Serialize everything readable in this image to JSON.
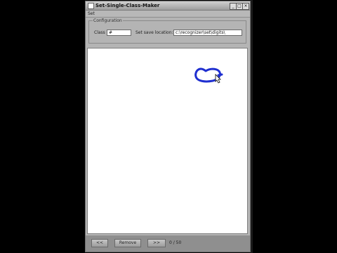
{
  "window": {
    "title": "Set-Single-Class-Maker",
    "minimize_label": "_",
    "maximize_label": "□",
    "close_label": "×"
  },
  "menu": {
    "items": [
      "Set"
    ]
  },
  "config": {
    "group_title": "Configuration",
    "class_label": "Class",
    "class_value": "#",
    "save_location_label": "Set save location:",
    "save_location_value": "c:\\recognizer\\set\\digits\\"
  },
  "canvas": {
    "stroke_color": "#1f2fd0"
  },
  "bottom": {
    "prev_label": "<<",
    "remove_label": "Remove",
    "next_label": ">>",
    "status": "0 / 50"
  }
}
